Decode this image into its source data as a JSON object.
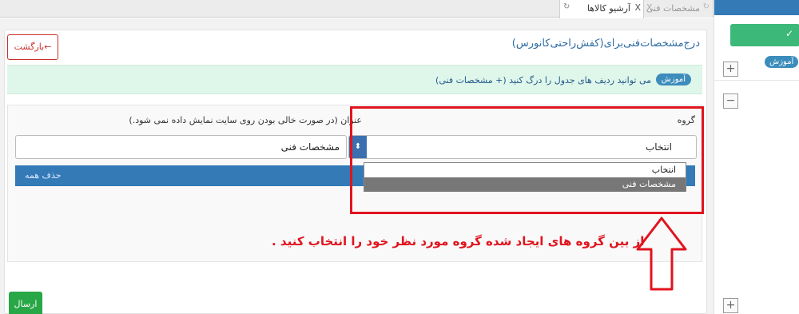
{
  "tabs": [
    {
      "label": "آرشیو کالاها",
      "active": true,
      "close_icon": "close-icon",
      "refresh_icon": "refresh-icon"
    },
    {
      "label": "مشخصات فنی",
      "active": false,
      "close_icon": "close-icon",
      "refresh_icon": "refresh-icon"
    }
  ],
  "header": {
    "title": "درج‌مشخصات‌فنی‌برای(کفش‌راحتی‌کانورس)",
    "back_label": "بازگشت←"
  },
  "info": {
    "badge": "آموزش",
    "text": "می توانید ردیف های جدول را درگ کنید (+ مشخصات فنی)"
  },
  "form": {
    "group_label": "گروه",
    "title_label": "عنوان (در صورت خالی بودن روی سایت نمایش داده نمی شود.)",
    "group_select": {
      "value": "انتخاب",
      "options": [
        "انتخاب",
        "مشخصات فنی"
      ],
      "highlighted_option": "مشخصات فنی"
    },
    "title_value": "مشخصات فنی",
    "delete_all": "حذف همه",
    "submit_label": "ارسال"
  },
  "annotation": {
    "text": "از بین گروه های ایجاد شده گروه مورد نظر خود را انتخاب کنید .",
    "color": "#e0141e"
  },
  "sidebar": {
    "badge": "آموزش",
    "green_button_label": "✓",
    "plus_label": "+",
    "minus_label": "−"
  },
  "colors": {
    "primary": "#337ab7",
    "success": "#27a745",
    "danger": "#c9302c",
    "info_bg": "#dff6ea"
  }
}
